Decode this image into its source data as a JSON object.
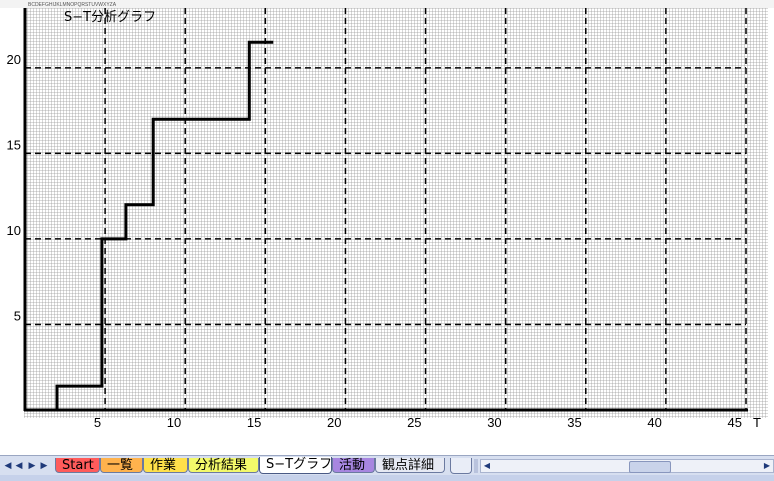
{
  "window": {
    "formula_bar_text": "BCDEFGHIJKLMNOPQRSTUVWXYZA"
  },
  "chart_data": {
    "type": "line",
    "title": "S−T分析グラフ",
    "xlabel": "T",
    "ylabel": "",
    "xlim": [
      0,
      45
    ],
    "ylim": [
      0,
      23.5
    ],
    "x_ticks": [
      5,
      10,
      15,
      20,
      25,
      30,
      35,
      40,
      45
    ],
    "y_ticks": [
      5,
      10,
      15,
      20
    ],
    "grid": true,
    "step": true,
    "series": [
      {
        "name": "",
        "x": [
          2,
          2,
          4.8,
          4.8,
          6.3,
          6.3,
          8,
          8,
          14,
          14,
          15.5
        ],
        "y": [
          0,
          1.4,
          1.4,
          10,
          10,
          12,
          12,
          17,
          17,
          21.5,
          21.5
        ]
      }
    ],
    "colors": {
      "line": "#000000",
      "grid_dash": "#000000",
      "cell_grid": "#a8a8a8"
    }
  },
  "tabbar": {
    "tabs": [
      {
        "label": "Start",
        "color": "#ff5b5b"
      },
      {
        "label": "一覧",
        "color": "#ffb24d"
      },
      {
        "label": "作業",
        "color": "#ffe04a"
      },
      {
        "label": "分析結果",
        "color": "#f3f96a"
      },
      {
        "label": "S−Tグラフ",
        "color": "#ffffff",
        "active": true
      },
      {
        "label": "活動",
        "color": "#a786e0"
      },
      {
        "label": "観点詳細",
        "color": "#e6e9f3"
      }
    ],
    "nav_icons": [
      "first-sheet-icon",
      "prev-sheet-icon",
      "next-sheet-icon",
      "last-sheet-icon"
    ],
    "new_sheet_icon": "insert-sheet-icon"
  }
}
